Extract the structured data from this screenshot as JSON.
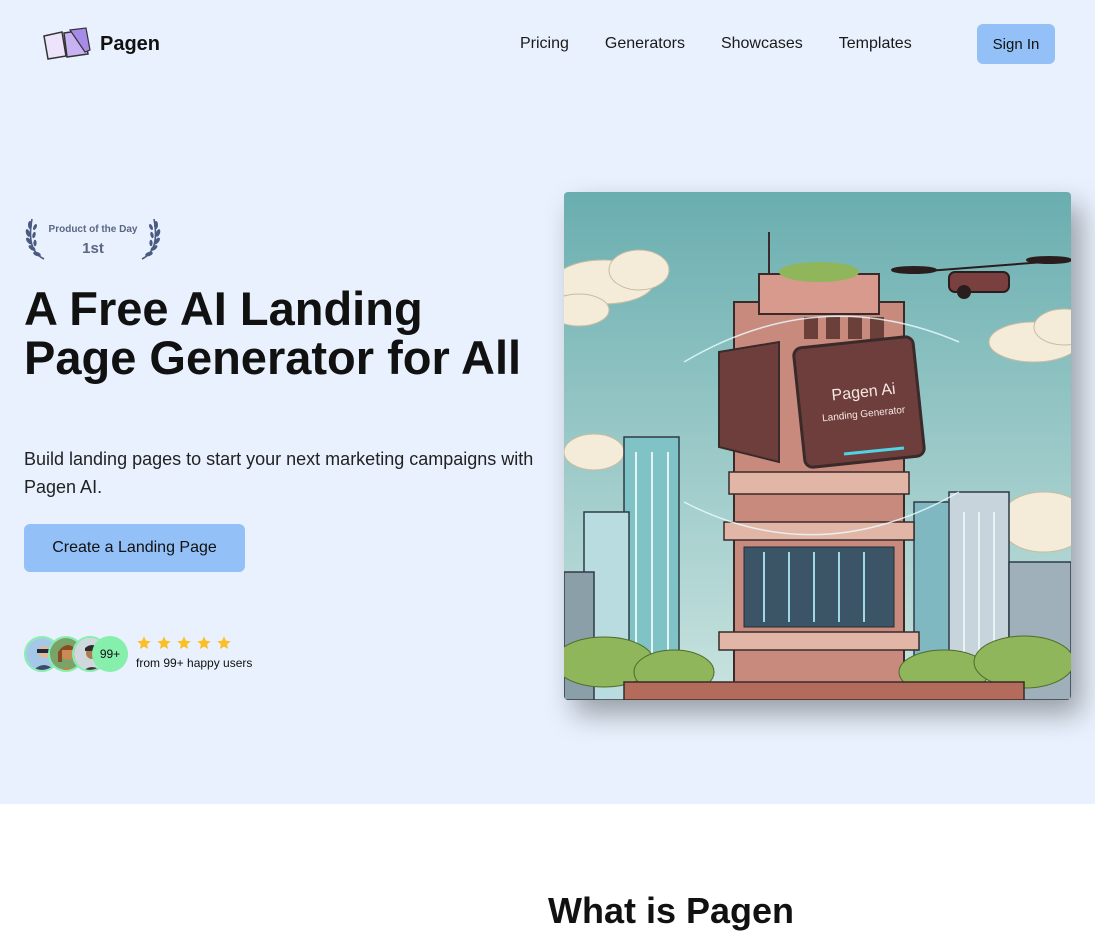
{
  "header": {
    "logo_text": "Pagen",
    "nav": [
      "Pricing",
      "Generators",
      "Showcases",
      "Templates"
    ],
    "signin_label": "Sign In"
  },
  "hero": {
    "badge": {
      "top": "Product of the Day",
      "rank": "1st"
    },
    "headline": "A Free AI Landing Page Generator for All",
    "subtitle": "Build landing pages to start your next marketing campaigns with Pagen AI.",
    "cta_label": "Create a Landing Page",
    "social_proof": {
      "avatar_count": "99+",
      "stars": 5,
      "text": "from 99+ happy users"
    },
    "illustration": {
      "screen_title": "Pagen Ai",
      "screen_subtitle": "Landing Generator"
    }
  },
  "section2": {
    "title": "What is Pagen"
  },
  "colors": {
    "hero_bg": "#e8f1fd",
    "button": "#93c0f7",
    "avatar_ring": "#86efac",
    "star": "#fbbf24"
  }
}
